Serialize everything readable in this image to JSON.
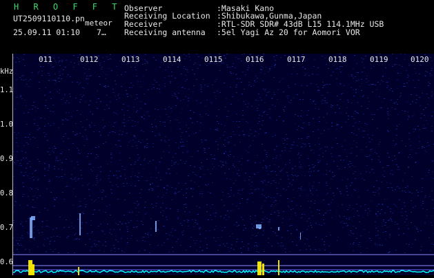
{
  "header": {
    "logo": "H R O F F T",
    "filename": "UT2509110110.pn",
    "tag": "meteor",
    "datetime": "25.09.11 01:10",
    "extra": "7…",
    "rows": [
      {
        "label": "Observer",
        "value": ":Masaki Kano"
      },
      {
        "label": "Receiving Location",
        "value": ":Shibukawa,Gunma,Japan"
      },
      {
        "label": "Receiver",
        "value": ":RTL-SDR SDR# 43dB L15 114.1MHz USB"
      },
      {
        "label": "Receiving antenna",
        "value": ":5el Yagi Az 20 for Aomori VOR"
      }
    ]
  },
  "axis": {
    "unit": "kHz",
    "time_ticks": [
      "011",
      "0112",
      "0113",
      "0114",
      "0115",
      "0116",
      "0117",
      "0118",
      "0119",
      "0120"
    ],
    "freq_ticks": [
      "1.1",
      "1.0",
      "0.9",
      "0.8",
      "0.7",
      "0.6"
    ]
  },
  "colors": {
    "background": "#000000",
    "spectrogram_base": "#00002a",
    "noise": "#1a2a9c",
    "meteor_echo": "#7fb0ff",
    "level_trace": "#00ffff",
    "peak": "#ffee00"
  }
}
